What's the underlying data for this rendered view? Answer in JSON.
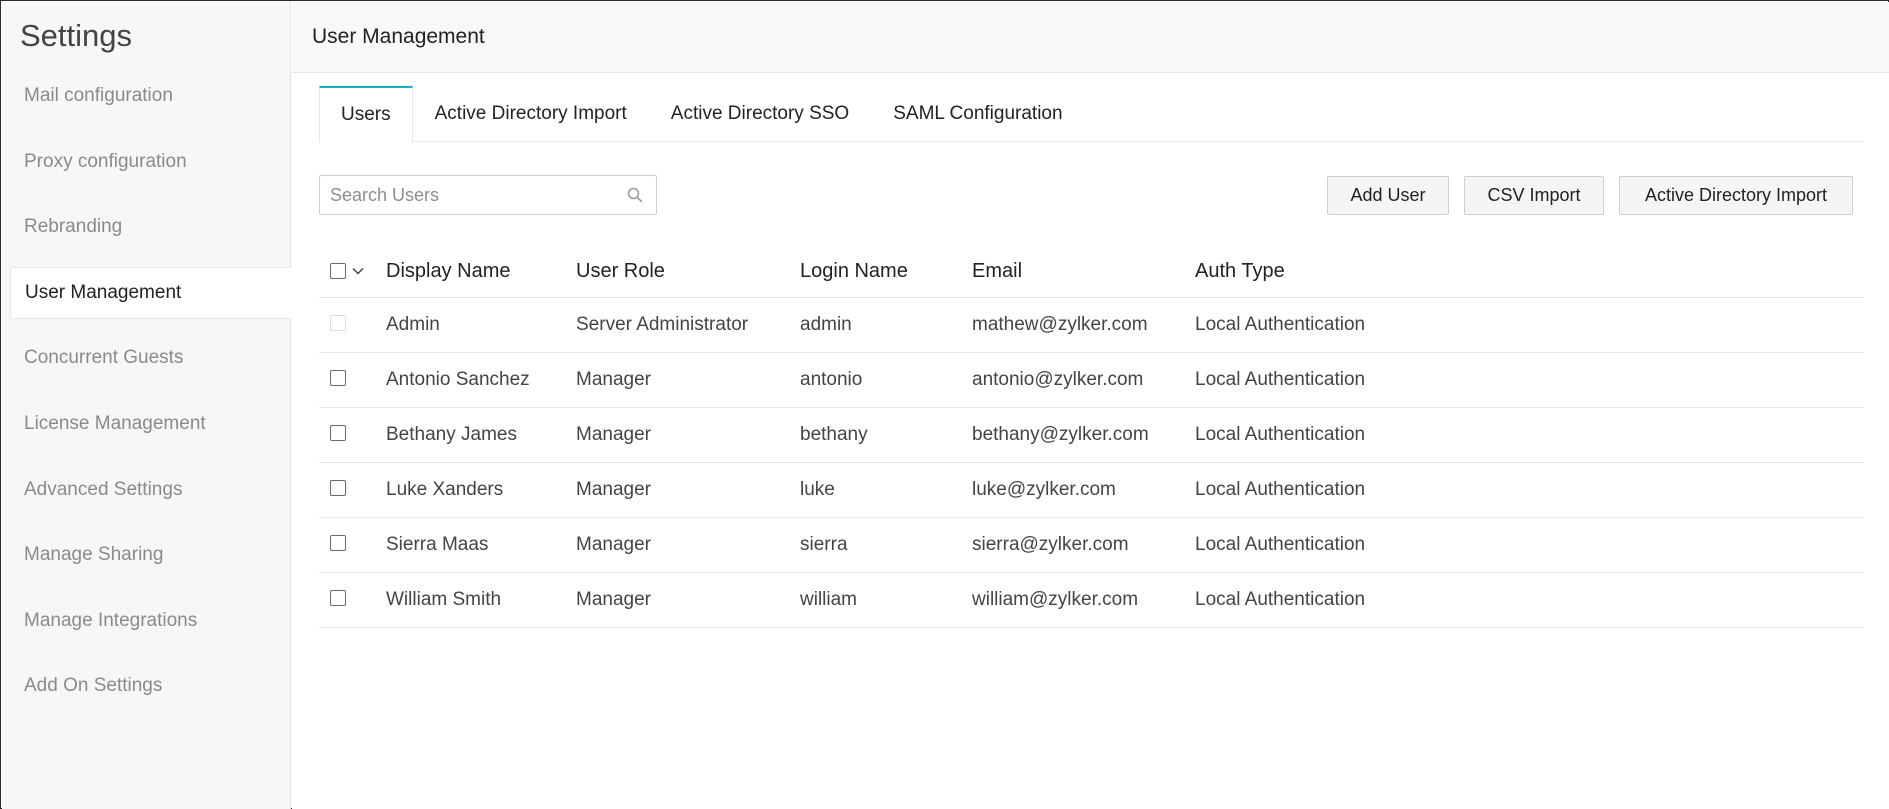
{
  "sidebar": {
    "title": "Settings",
    "items": [
      {
        "label": "Mail configuration"
      },
      {
        "label": "Proxy configuration"
      },
      {
        "label": "Rebranding"
      },
      {
        "label": "User Management",
        "active": true
      },
      {
        "label": "Concurrent Guests"
      },
      {
        "label": "License Management"
      },
      {
        "label": "Advanced Settings"
      },
      {
        "label": "Manage Sharing"
      },
      {
        "label": "Manage Integrations"
      },
      {
        "label": "Add On Settings"
      }
    ]
  },
  "header": {
    "title": "User Management"
  },
  "tabs": [
    {
      "label": "Users",
      "active": true
    },
    {
      "label": "Active Directory Import"
    },
    {
      "label": "Active Directory SSO"
    },
    {
      "label": "SAML Configuration"
    }
  ],
  "search": {
    "placeholder": "Search Users",
    "value": ""
  },
  "actions": {
    "add_user": "Add User",
    "csv_import": "CSV Import",
    "ad_import": "Active Directory Import"
  },
  "table": {
    "columns": [
      "Display Name",
      "User Role",
      "Login Name",
      "Email",
      "Auth Type"
    ],
    "rows": [
      {
        "display_name": "Admin",
        "role": "Server Administrator",
        "login": "admin",
        "email": "mathew@zylker.com",
        "auth": "Local Authentication",
        "selectable": false
      },
      {
        "display_name": "Antonio Sanchez",
        "role": "Manager",
        "login": "antonio",
        "email": "antonio@zylker.com",
        "auth": "Local Authentication",
        "selectable": true
      },
      {
        "display_name": "Bethany James",
        "role": "Manager",
        "login": "bethany",
        "email": "bethany@zylker.com",
        "auth": "Local Authentication",
        "selectable": true
      },
      {
        "display_name": "Luke Xanders",
        "role": "Manager",
        "login": "luke",
        "email": "luke@zylker.com",
        "auth": "Local Authentication",
        "selectable": true
      },
      {
        "display_name": "Sierra Maas",
        "role": "Manager",
        "login": "sierra",
        "email": "sierra@zylker.com",
        "auth": "Local Authentication",
        "selectable": true
      },
      {
        "display_name": "William Smith",
        "role": "Manager",
        "login": "william",
        "email": "william@zylker.com",
        "auth": "Local Authentication",
        "selectable": true
      }
    ]
  },
  "colors": {
    "accent": "#19b3c4"
  }
}
